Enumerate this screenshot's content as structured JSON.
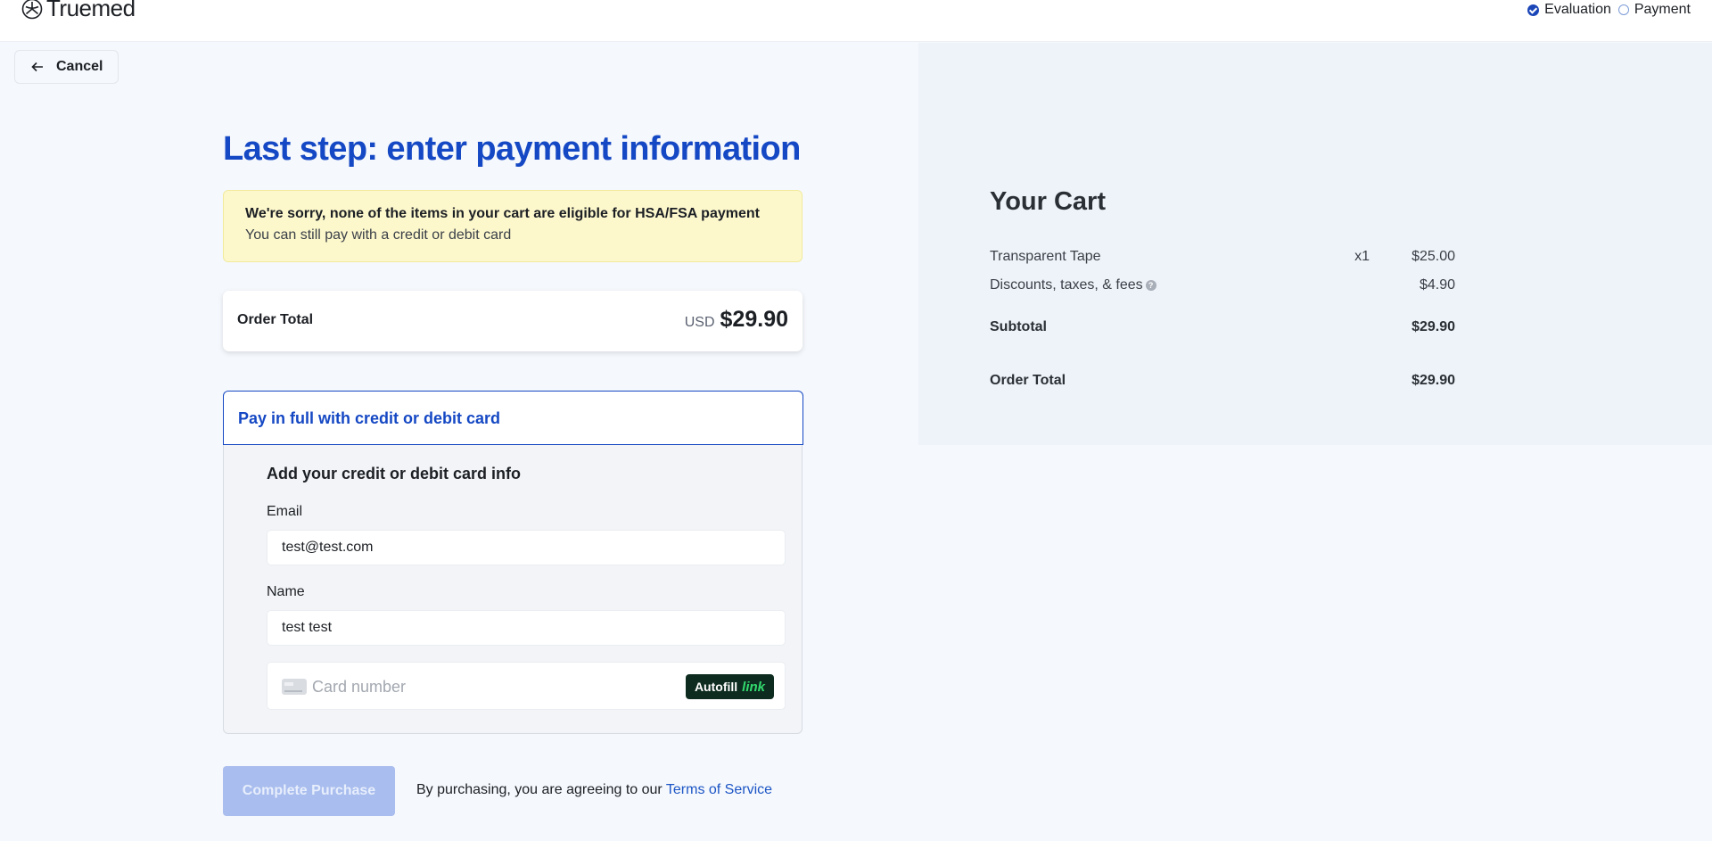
{
  "header": {
    "brand": "Truemed",
    "steps": [
      {
        "label": "Evaluation",
        "state": "done"
      },
      {
        "label": "Payment",
        "state": "pending"
      }
    ]
  },
  "cancel_label": "Cancel",
  "page_title": "Last step: enter payment information",
  "notice": {
    "title": "We're sorry, none of the items in your cart are eligible for HSA/FSA payment",
    "subtitle": "You can still pay with a credit or debit card"
  },
  "order_total": {
    "label": "Order Total",
    "currency": "USD",
    "amount": "$29.90"
  },
  "payment": {
    "option_label": "Pay in full with credit or debit card",
    "form_title": "Add your credit or debit card info",
    "email_label": "Email",
    "email_value": "test@test.com",
    "name_label": "Name",
    "name_value": "test test",
    "card_placeholder": "Card number",
    "autofill_label": "Autofill",
    "link_label": "link"
  },
  "purchase": {
    "button_label": "Complete Purchase",
    "terms_prefix": "By purchasing, you are agreeing to our ",
    "terms_link": "Terms of Service"
  },
  "cart": {
    "title": "Your Cart",
    "items": [
      {
        "name": "Transparent Tape",
        "qty": "x1",
        "price": "$25.00"
      }
    ],
    "fees_label": "Discounts, taxes, & fees",
    "fees_amount": "$4.90",
    "subtotal_label": "Subtotal",
    "subtotal_amount": "$29.90",
    "total_label": "Order Total",
    "total_amount": "$29.90"
  },
  "colors": {
    "brand_blue": "#1548c4",
    "notice_bg": "#fdf8cc",
    "disabled_button": "#a9bdee",
    "link_green": "#33d96e"
  }
}
